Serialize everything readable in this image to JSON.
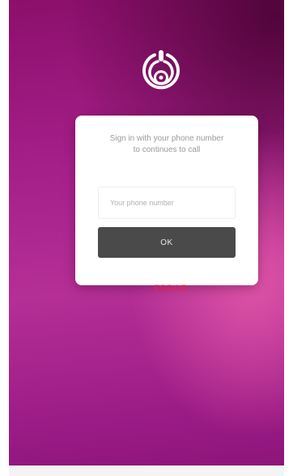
{
  "login": {
    "message_line1": "Sign in with your phone number",
    "message_line2": "to continues to call",
    "phone_placeholder": "Your phone number",
    "phone_value": "",
    "ok_label": "OK",
    "error_text": "ERROR"
  },
  "colors": {
    "background_primary": "#a6208a",
    "background_accent": "#e65aaa",
    "card": "#ffffff",
    "button": "#4a4a4a",
    "error": "#ff1f3a"
  },
  "icons": {
    "logo": "concentric-circles-logo-icon"
  }
}
